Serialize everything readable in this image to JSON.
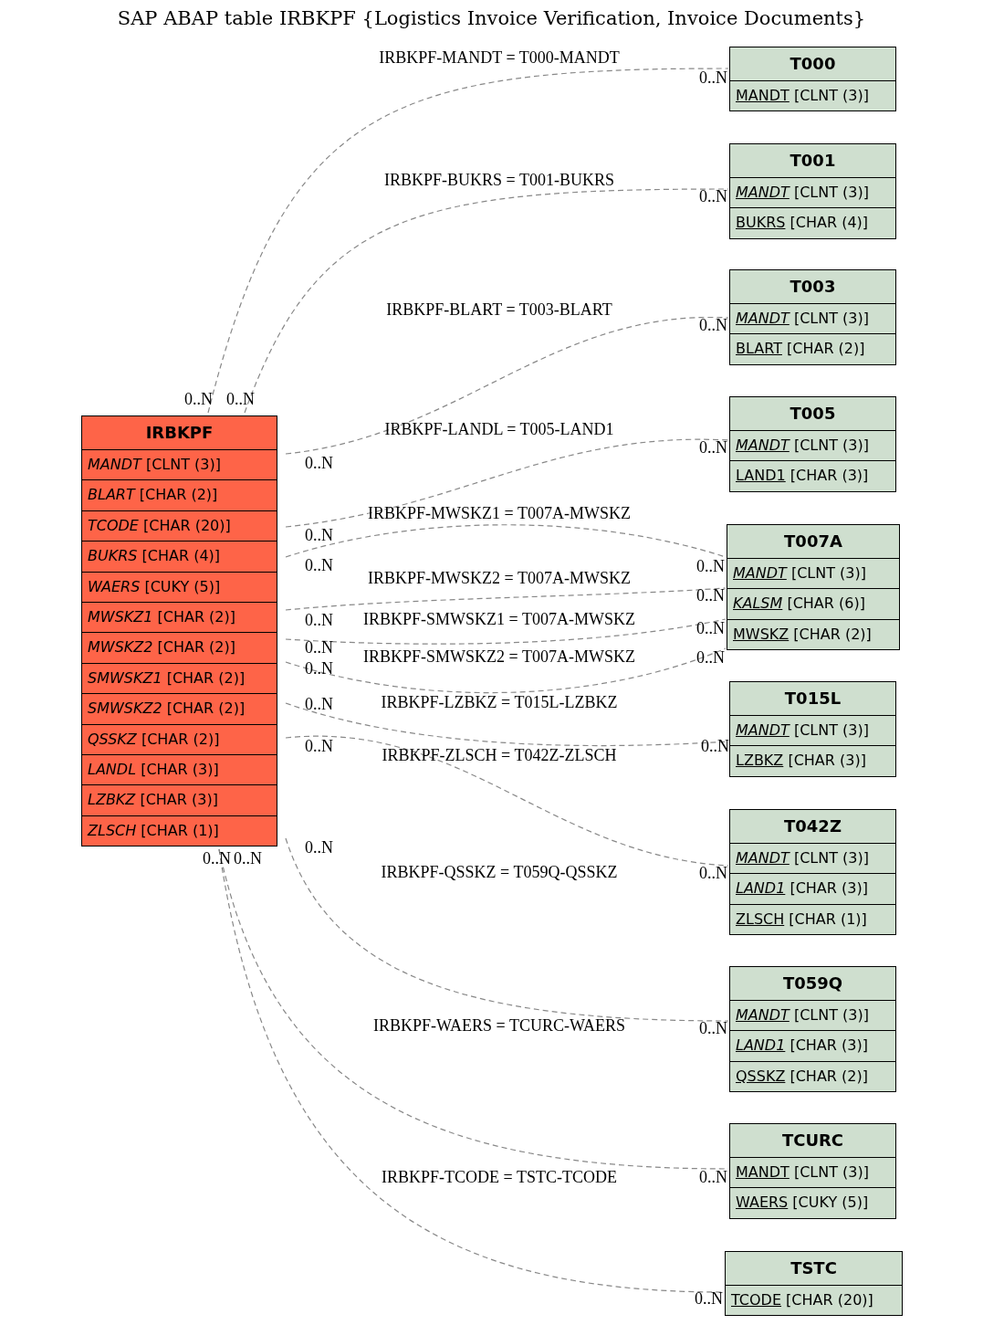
{
  "title": "SAP ABAP table IRBKPF {Logistics Invoice Verification, Invoice Documents}",
  "main_table": {
    "name": "IRBKPF",
    "fields": [
      {
        "name": "MANDT",
        "type": "[CLNT (3)]",
        "italic": true,
        "underlined": false
      },
      {
        "name": "BLART",
        "type": "[CHAR (2)]",
        "italic": true,
        "underlined": false
      },
      {
        "name": "TCODE",
        "type": "[CHAR (20)]",
        "italic": true,
        "underlined": false
      },
      {
        "name": "BUKRS",
        "type": "[CHAR (4)]",
        "italic": true,
        "underlined": false
      },
      {
        "name": "WAERS",
        "type": "[CUKY (5)]",
        "italic": true,
        "underlined": false
      },
      {
        "name": "MWSKZ1",
        "type": "[CHAR (2)]",
        "italic": true,
        "underlined": false
      },
      {
        "name": "MWSKZ2",
        "type": "[CHAR (2)]",
        "italic": true,
        "underlined": false
      },
      {
        "name": "SMWSKZ1",
        "type": "[CHAR (2)]",
        "italic": true,
        "underlined": false
      },
      {
        "name": "SMWSKZ2",
        "type": "[CHAR (2)]",
        "italic": true,
        "underlined": false
      },
      {
        "name": "QSSKZ",
        "type": "[CHAR (2)]",
        "italic": true,
        "underlined": false
      },
      {
        "name": "LANDL",
        "type": "[CHAR (3)]",
        "italic": true,
        "underlined": false
      },
      {
        "name": "LZBKZ",
        "type": "[CHAR (3)]",
        "italic": true,
        "underlined": false
      },
      {
        "name": "ZLSCH",
        "type": "[CHAR (1)]",
        "italic": true,
        "underlined": false
      }
    ]
  },
  "related_tables": [
    {
      "name": "T000",
      "fields": [
        {
          "name": "MANDT",
          "type": "[CLNT (3)]",
          "italic": false,
          "underlined": true
        }
      ]
    },
    {
      "name": "T001",
      "fields": [
        {
          "name": "MANDT",
          "type": "[CLNT (3)]",
          "italic": true,
          "underlined": true
        },
        {
          "name": "BUKRS",
          "type": "[CHAR (4)]",
          "italic": false,
          "underlined": true
        }
      ]
    },
    {
      "name": "T003",
      "fields": [
        {
          "name": "MANDT",
          "type": "[CLNT (3)]",
          "italic": true,
          "underlined": true
        },
        {
          "name": "BLART",
          "type": "[CHAR (2)]",
          "italic": false,
          "underlined": true
        }
      ]
    },
    {
      "name": "T005",
      "fields": [
        {
          "name": "MANDT",
          "type": "[CLNT (3)]",
          "italic": true,
          "underlined": true
        },
        {
          "name": "LAND1",
          "type": "[CHAR (3)]",
          "italic": false,
          "underlined": true
        }
      ]
    },
    {
      "name": "T007A",
      "fields": [
        {
          "name": "MANDT",
          "type": "[CLNT (3)]",
          "italic": true,
          "underlined": true
        },
        {
          "name": "KALSM",
          "type": "[CHAR (6)]",
          "italic": true,
          "underlined": true
        },
        {
          "name": "MWSKZ",
          "type": "[CHAR (2)]",
          "italic": false,
          "underlined": true
        }
      ]
    },
    {
      "name": "T015L",
      "fields": [
        {
          "name": "MANDT",
          "type": "[CLNT (3)]",
          "italic": true,
          "underlined": true
        },
        {
          "name": "LZBKZ",
          "type": "[CHAR (3)]",
          "italic": false,
          "underlined": true
        }
      ]
    },
    {
      "name": "T042Z",
      "fields": [
        {
          "name": "MANDT",
          "type": "[CLNT (3)]",
          "italic": true,
          "underlined": true
        },
        {
          "name": "LAND1",
          "type": "[CHAR (3)]",
          "italic": true,
          "underlined": true
        },
        {
          "name": "ZLSCH",
          "type": "[CHAR (1)]",
          "italic": false,
          "underlined": true
        }
      ]
    },
    {
      "name": "T059Q",
      "fields": [
        {
          "name": "MANDT",
          "type": "[CLNT (3)]",
          "italic": true,
          "underlined": true
        },
        {
          "name": "LAND1",
          "type": "[CHAR (3)]",
          "italic": true,
          "underlined": true
        },
        {
          "name": "QSSKZ",
          "type": "[CHAR (2)]",
          "italic": false,
          "underlined": true
        }
      ]
    },
    {
      "name": "TCURC",
      "fields": [
        {
          "name": "MANDT",
          "type": "[CLNT (3)]",
          "italic": false,
          "underlined": true
        },
        {
          "name": "WAERS",
          "type": "[CUKY (5)]",
          "italic": false,
          "underlined": true
        }
      ]
    },
    {
      "name": "TSTC",
      "fields": [
        {
          "name": "TCODE",
          "type": "[CHAR (20)]",
          "italic": false,
          "underlined": true
        }
      ]
    }
  ],
  "relations": [
    {
      "label": "IRBKPF-MANDT = T000-MANDT",
      "source_cardinality": "0..N",
      "target_cardinality": "0..N"
    },
    {
      "label": "IRBKPF-BUKRS = T001-BUKRS",
      "source_cardinality": "0..N",
      "target_cardinality": "0..N"
    },
    {
      "label": "IRBKPF-BLART = T003-BLART",
      "source_cardinality": "0..N",
      "target_cardinality": "0..N"
    },
    {
      "label": "IRBKPF-LANDL = T005-LAND1",
      "source_cardinality": "0..N",
      "target_cardinality": "0..N"
    },
    {
      "label": "IRBKPF-MWSKZ1 = T007A-MWSKZ",
      "source_cardinality": "0..N",
      "target_cardinality": "0..N"
    },
    {
      "label": "IRBKPF-MWSKZ2 = T007A-MWSKZ",
      "source_cardinality": "0..N",
      "target_cardinality": "0..N"
    },
    {
      "label": "IRBKPF-SMWSKZ1 = T007A-MWSKZ",
      "source_cardinality": "0..N",
      "target_cardinality": "0..N"
    },
    {
      "label": "IRBKPF-SMWSKZ2 = T007A-MWSKZ",
      "source_cardinality": "0..N",
      "target_cardinality": "0..N"
    },
    {
      "label": "IRBKPF-LZBKZ = T015L-LZBKZ",
      "source_cardinality": "0..N",
      "target_cardinality": "0..N"
    },
    {
      "label": "IRBKPF-ZLSCH = T042Z-ZLSCH",
      "source_cardinality": "0..N",
      "target_cardinality": "0..N"
    },
    {
      "label": "IRBKPF-QSSKZ = T059Q-QSSKZ",
      "source_cardinality": "0..N",
      "target_cardinality": "0..N"
    },
    {
      "label": "IRBKPF-WAERS = TCURC-WAERS",
      "source_cardinality": "0..N",
      "target_cardinality": "0..N"
    },
    {
      "label": "IRBKPF-TCODE = TSTC-TCODE",
      "source_cardinality": "0..N",
      "target_cardinality": "0..N"
    }
  ]
}
